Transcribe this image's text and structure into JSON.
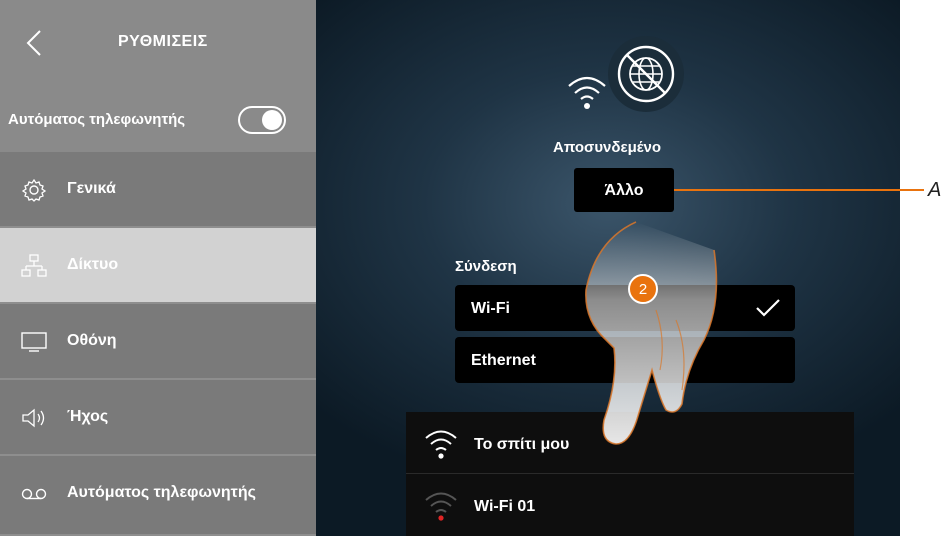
{
  "sidebar": {
    "title": "ΡΥΘΜΙΣΕΙΣ",
    "back_icon": "chevron-left-icon",
    "answering_toggle_label": "Αυτόματος τηλεφωνητής",
    "answering_toggle_on": true,
    "items": [
      {
        "label": "Γενικά",
        "icon": "gear-icon",
        "selected": false
      },
      {
        "label": "Δίκτυο",
        "icon": "network-icon",
        "selected": true
      },
      {
        "label": "Οθόνη",
        "icon": "monitor-icon",
        "selected": false
      },
      {
        "label": "Ήχος",
        "icon": "speaker-icon",
        "selected": false
      },
      {
        "label": "Αυτόματος τηλεφωνητής",
        "icon": "voicemail-icon",
        "selected": false
      }
    ]
  },
  "main": {
    "status_icon": "globe-disconnected-icon",
    "wifi_icon": "wifi-icon",
    "status_text": "Αποσυνδεμένο",
    "other_button_label": "Άλλο",
    "connection_label": "Σύνδεση",
    "connection_options": [
      {
        "label": "Wi-Fi",
        "selected": true
      },
      {
        "label": "Ethernet",
        "selected": false
      }
    ],
    "networks": [
      {
        "name": "Το σπίτι μου",
        "signal_icon": "wifi-full-icon"
      },
      {
        "name": "Wi-Fi 01",
        "signal_icon": "wifi-weak-icon"
      }
    ],
    "step_badge": "2"
  },
  "annotation": {
    "label": "A",
    "color": "#e9730e"
  },
  "colors": {
    "sidebar_bg": "#8a8a8a",
    "menu_item_bg": "#7a7a7a",
    "selected_bg": "#d2d2d2",
    "accent_orange": "#e9730e",
    "main_bg": "#1f3445"
  }
}
